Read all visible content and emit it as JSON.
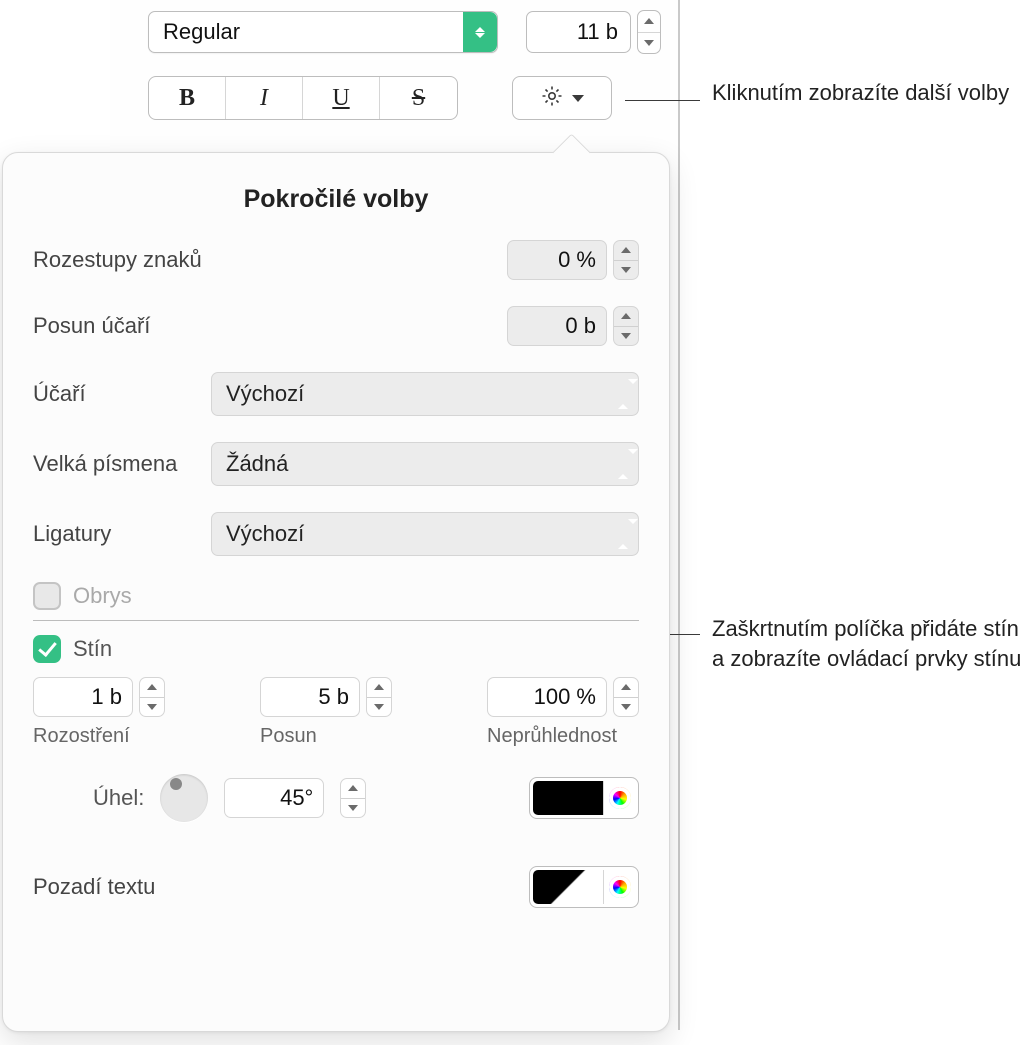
{
  "top": {
    "font_style": "Regular",
    "font_size": "11 b"
  },
  "style_buttons": {
    "bold": "B",
    "italic": "I",
    "underline": "U",
    "strike": "S"
  },
  "callouts": {
    "gear": "Kliknutím zobrazíte další volby",
    "shadow": "Zaškrtnutím políčka přidáte stín a zobrazíte ovládací prvky stínu"
  },
  "popover": {
    "title": "Pokročilé volby",
    "char_spacing": {
      "label": "Rozestupy znaků",
      "value": "0 %"
    },
    "baseline_shift": {
      "label": "Posun účaří",
      "value": "0 b"
    },
    "baseline": {
      "label": "Účaří",
      "value": "Výchozí"
    },
    "caps": {
      "label": "Velká písmena",
      "value": "Žádná"
    },
    "ligatures": {
      "label": "Ligatury",
      "value": "Výchozí"
    },
    "outline": {
      "label": "Obrys"
    },
    "shadow": {
      "label": "Stín",
      "blur": {
        "value": "1 b",
        "label": "Rozostření"
      },
      "offset": {
        "value": "5 b",
        "label": "Posun"
      },
      "opacity": {
        "value": "100 %",
        "label": "Neprůhlednost"
      },
      "angle": {
        "label": "Úhel:",
        "value": "45°"
      }
    },
    "text_bg": {
      "label": "Pozadí textu"
    }
  }
}
